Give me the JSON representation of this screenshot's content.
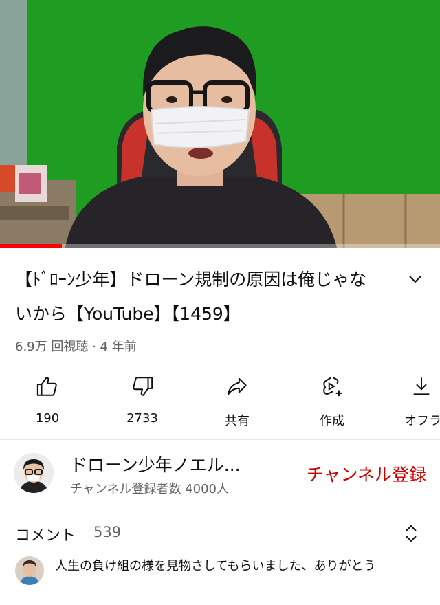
{
  "video": {
    "progress_fraction": 0.14,
    "colors": {
      "green_screen": "#1f9d22",
      "progress": "#ff0000"
    }
  },
  "title": "【ﾄﾞﾛｰﾝ少年】ドローン規制の原因は俺じゃないから【YouTube】【1459】",
  "meta": "6.9万 回視聴 · 4 年前",
  "actions": {
    "like": {
      "icon": "thumbs-up-icon",
      "label": "190"
    },
    "dislike": {
      "icon": "thumbs-down-icon",
      "label": "2733"
    },
    "share": {
      "icon": "share-icon",
      "label": "共有"
    },
    "remix": {
      "icon": "remix-icon",
      "label": "作成"
    },
    "offline": {
      "icon": "download-icon",
      "label": "オフラ"
    }
  },
  "channel": {
    "name": "ドローン少年ノエル...",
    "subscribers": "チャンネル登録者数 4000人",
    "subscribe_label": "チャンネル登録",
    "subscribe_color": "#cc0000"
  },
  "comments": {
    "heading": "コメント",
    "count": "539",
    "first_comment": "人生の負け組の様を見物さしてもらいました、ありがとう"
  }
}
